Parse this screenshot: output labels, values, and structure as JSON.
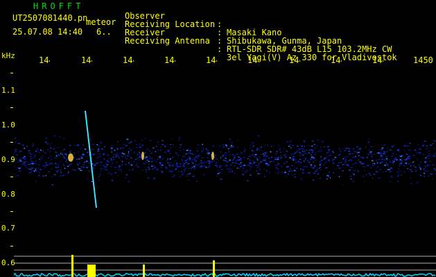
{
  "header": {
    "brand": "HROFFT",
    "filename": "UT2507081440.pn",
    "meteor_label": "meteor",
    "datetime": "25.07.08 14:40",
    "count": "6.."
  },
  "station": [
    {
      "label": "Observer",
      "value": "Masaki Kano"
    },
    {
      "label": "Receiving Location",
      "value": "Shibukawa, Gunma, Japan"
    },
    {
      "label": "Receiver",
      "value": "RTL-SDR SDR# 43dB L15 103.2MHz CW"
    },
    {
      "label": "Receiving Antenna",
      "value": "3el Yagi(V) Az 330 for Vladivostok"
    }
  ],
  "separator": ":",
  "axes": {
    "y_unit": "kHz",
    "y_ticks": [
      "1.1",
      "1.0",
      "0.9",
      "0.8",
      "0.7",
      "0.6"
    ],
    "x_ticks": [
      "1441",
      "1442",
      "1443",
      "1444",
      "1445",
      "1446",
      "1447",
      "1448",
      "1449",
      "1450"
    ]
  },
  "colors": {
    "label_text": "#ffff00",
    "brand_text": "#00e000",
    "background": "#000000",
    "noise_band": "#0a1aa0",
    "meteor_trail": "#40e0ff",
    "power_trace": "#00d8ff",
    "power_peaks": "#ffff00"
  },
  "display": {
    "echo_band_khz": [
      0.82,
      0.98
    ],
    "meteor_trail_khz": [
      1.04,
      0.76
    ]
  }
}
